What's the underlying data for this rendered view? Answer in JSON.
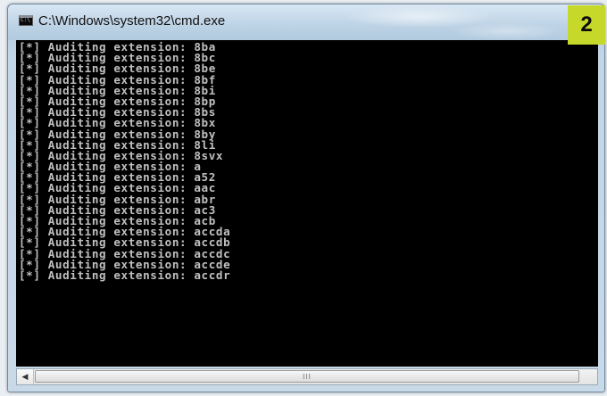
{
  "window": {
    "title": "C:\\Windows\\system32\\cmd.exe",
    "icon_label": "C:\\"
  },
  "badge": {
    "number": "2",
    "color": "#c6d82a"
  },
  "console": {
    "lines": [
      "[*] Auditing extension: 8ba",
      "[*] Auditing extension: 8bc",
      "[*] Auditing extension: 8be",
      "[*] Auditing extension: 8bf",
      "[*] Auditing extension: 8bi",
      "[*] Auditing extension: 8bp",
      "[*] Auditing extension: 8bs",
      "[*] Auditing extension: 8bx",
      "[*] Auditing extension: 8by",
      "[*] Auditing extension: 8li",
      "[*] Auditing extension: 8svx",
      "[*] Auditing extension: a",
      "[*] Auditing extension: a52",
      "[*] Auditing extension: aac",
      "[*] Auditing extension: abr",
      "[*] Auditing extension: ac3",
      "[*] Auditing extension: acb",
      "[*] Auditing extension: accda",
      "[*] Auditing extension: accdb",
      "[*] Auditing extension: accdc",
      "[*] Auditing extension: accde",
      "[*] Auditing extension: accdr"
    ],
    "text_color": "#c0c0c0",
    "background": "#000000"
  },
  "scrollbar": {
    "left_arrow_icon": "scroll-left-arrow-icon",
    "grip_icon": "scroll-grip-icon",
    "grip_glyph": "III"
  }
}
